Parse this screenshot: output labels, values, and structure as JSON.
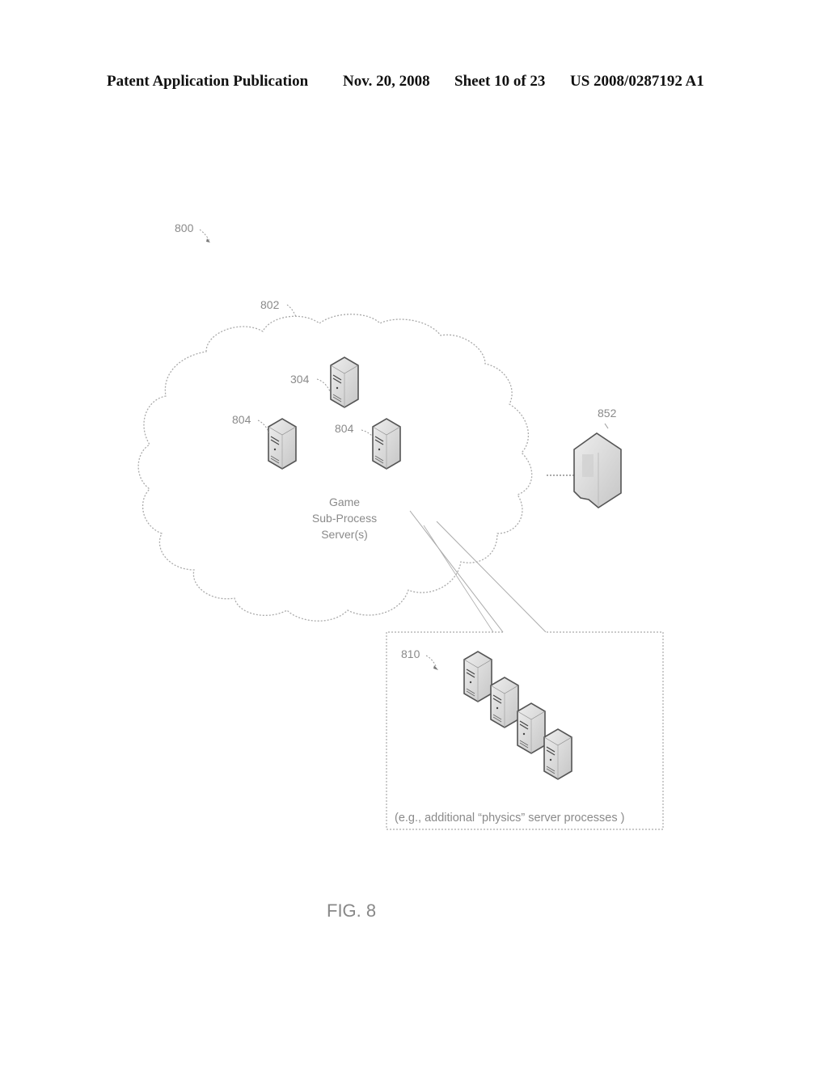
{
  "header": {
    "publication": "Patent Application Publication",
    "date": "Nov. 20, 2008",
    "sheet": "Sheet 10 of 23",
    "patent_number": "US 2008/0287192 A1"
  },
  "figure": {
    "label": "FIG. 8",
    "system_ref": "800",
    "cloud": {
      "ref": "802",
      "caption_lines": [
        "Game",
        "Sub-Process",
        "Server(s)"
      ],
      "servers": [
        {
          "ref": "304"
        },
        {
          "ref": "804"
        },
        {
          "ref": "804"
        }
      ]
    },
    "external_server": {
      "ref": "852"
    },
    "detail_box": {
      "ref": "810",
      "server_count": 4,
      "caption": "(e.g., additional “physics” server processes )"
    }
  },
  "colors": {
    "outline": "#999999",
    "server_fill": "#d9d9d9",
    "server_stroke": "#555555",
    "text": "#8a8a8a"
  }
}
